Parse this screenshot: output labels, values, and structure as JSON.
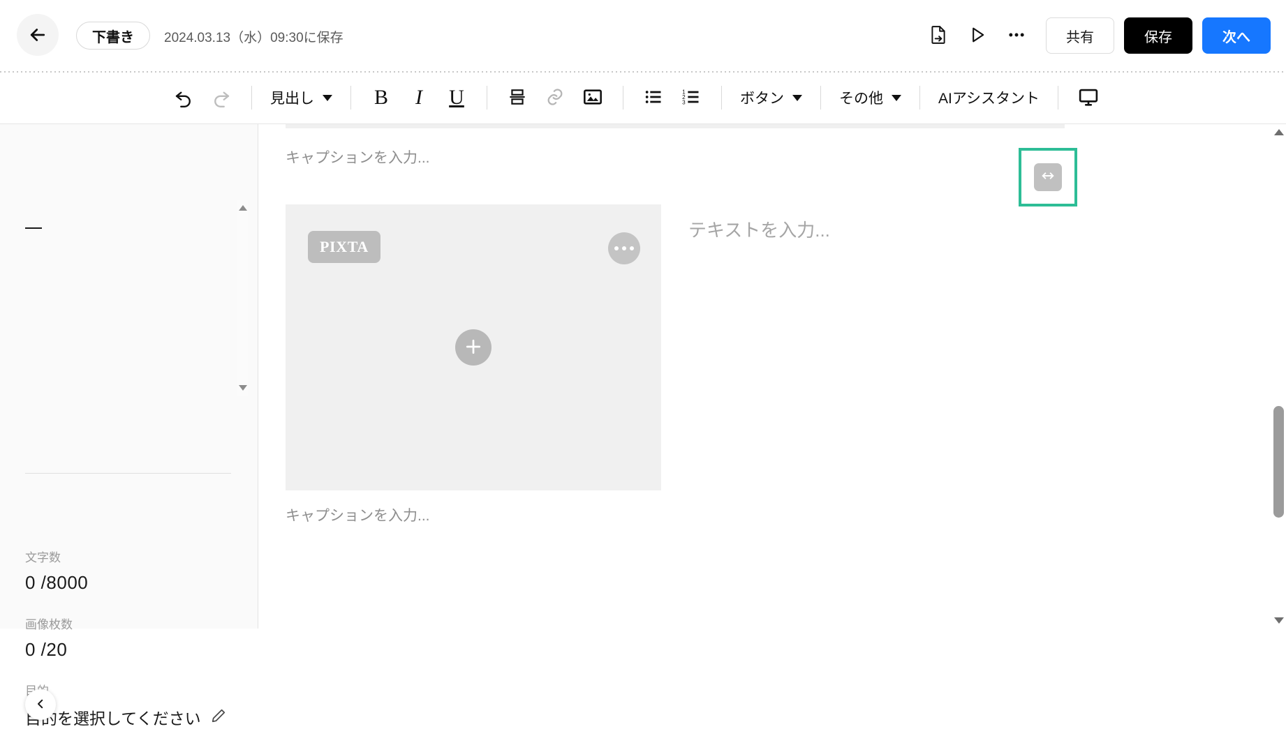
{
  "header": {
    "back_icon": "arrow-left-icon",
    "status_chip": "下書き",
    "saved_text": "2024.03.13（水）09:30に保存",
    "export_icon": "file-export-icon",
    "preview_icon": "play-triangle-icon",
    "more_icon": "ellipsis-icon",
    "share_label": "共有",
    "save_label": "保存",
    "next_label": "次へ"
  },
  "toolbar": {
    "undo_icon": "undo-arrow-icon",
    "redo_icon": "redo-arrow-icon",
    "heading_label": "見出し",
    "bold_label": "B",
    "italic_label": "I",
    "underline_label": "U",
    "divider_icon": "horizontal-divider-icon",
    "link_icon": "link-icon",
    "image_icon": "image-icon",
    "bullet_list_icon": "bullet-list-icon",
    "numbered_list_icon": "numbered-list-icon",
    "button_label": "ボタン",
    "other_label": "その他",
    "ai_assistant_label": "AIアシスタント",
    "preview_monitor_icon": "monitor-icon"
  },
  "sidebar": {
    "char_count": {
      "label": "文字数",
      "value": "0 /8000"
    },
    "image_count": {
      "label": "画像枚数",
      "value": "0 /20"
    },
    "purpose": {
      "label": "目的",
      "value": "目的を選択してください",
      "edit_icon": "pencil-icon"
    },
    "collapse_icon": "chevron-left-icon",
    "scroll_up_icon": "triangle-up-icon",
    "scroll_down_icon": "triangle-down-icon"
  },
  "editor": {
    "caption_top_placeholder": "キャプションを入力...",
    "caption_bottom_placeholder": "キャプションを入力...",
    "text_placeholder": "テキストを入力...",
    "image_block": {
      "badge": "PIXTA",
      "more_icon": "ellipsis-circle-icon",
      "add_icon": "plus-circle-icon"
    },
    "resize_handle": {
      "icon": "horizontal-resize-arrow-icon",
      "selection_color": "#2dbd96"
    }
  },
  "scrollbar": {
    "up_icon": "triangle-up-icon",
    "down_icon": "triangle-down-icon",
    "thumb": "scroll-thumb"
  },
  "colors": {
    "primary": "#1677ff",
    "dark": "#000000",
    "selection_teal": "#2dbd96",
    "sidebar_bg": "#fafafa",
    "placeholder_gray": "#f0f0f0"
  }
}
